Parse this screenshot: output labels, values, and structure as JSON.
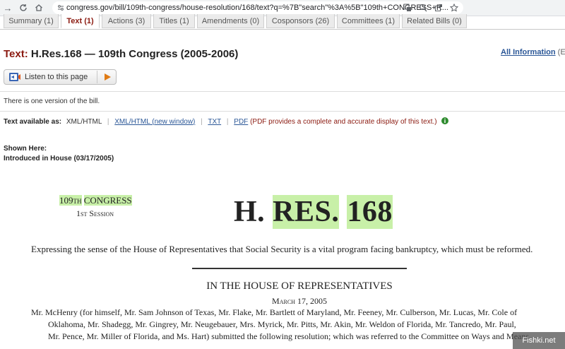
{
  "browser": {
    "url": "congress.gov/bill/109th-congress/house-resolution/168/text?q=%7B\"search\"%3A%5B\"109th+CONGRESS+R..."
  },
  "tabs": [
    {
      "label": "Summary (1)",
      "active": false
    },
    {
      "label": "Text (1)",
      "active": true
    },
    {
      "label": "Actions (3)",
      "active": false
    },
    {
      "label": "Titles (1)",
      "active": false
    },
    {
      "label": "Amendments (0)",
      "active": false
    },
    {
      "label": "Cosponsors (26)",
      "active": false
    },
    {
      "label": "Committees (1)",
      "active": false
    },
    {
      "label": "Related Bills (0)",
      "active": false
    }
  ],
  "header": {
    "title_label": "Text:",
    "title": "H.Res.168 — 109th Congress (2005-2006)",
    "all_information": "All Information",
    "all_information_suffix": "(Ex"
  },
  "listen": {
    "label": "Listen to this page"
  },
  "versions_note": "There is one version of the bill.",
  "text_available": {
    "label": "Text available as:",
    "current": "XML/HTML",
    "new_window_prefix": "XML/HTML (",
    "new_window_link": "new window",
    "new_window_suffix": ")",
    "txt": "TXT",
    "pdf": "PDF",
    "pdf_note": "(PDF provides a complete and accurate display of this text.)"
  },
  "shown_here": {
    "label": "Shown Here:",
    "version": "Introduced in House (03/17/2005)"
  },
  "bill": {
    "congress_num": "109th",
    "congress_word": "CONGRESS",
    "session": "1st Session",
    "bill_prefix": "H.",
    "bill_mid": "RES.",
    "bill_number": "168",
    "purpose": "Expressing the sense of the House of Representatives that Social Security is a vital program facing bankruptcy, which must be reformed.",
    "chamber": "IN THE HOUSE OF REPRESENTATIVES",
    "date": "March 17, 2005",
    "sponsors_line1": "Mr. McHenry (for himself, Mr. Sam Johnson of Texas, Mr. Flake, Mr. Bartlett of Maryland, Mr. Feeney, Mr. Culberson, Mr. Lucas, Mr. Cole of",
    "sponsors_line2": "Oklahoma, Mr. Shadegg, Mr. Gingrey, Mr. Neugebauer, Mrs. Myrick, Mr. Pitts, Mr. Akin, Mr. Weldon of Florida, Mr. Tancredo, Mr. Paul,",
    "sponsors_line3": "Mr. Pence, Mr. Miller of Florida, and Ms. Hart) submitted the following resolution; which was referred to the Committee on Ways and Means"
  },
  "watermark": "Fishki.net",
  "colors": {
    "accent_red": "#8b1a10",
    "link_blue": "#2b5797",
    "highlight": "#c8f0a8"
  }
}
